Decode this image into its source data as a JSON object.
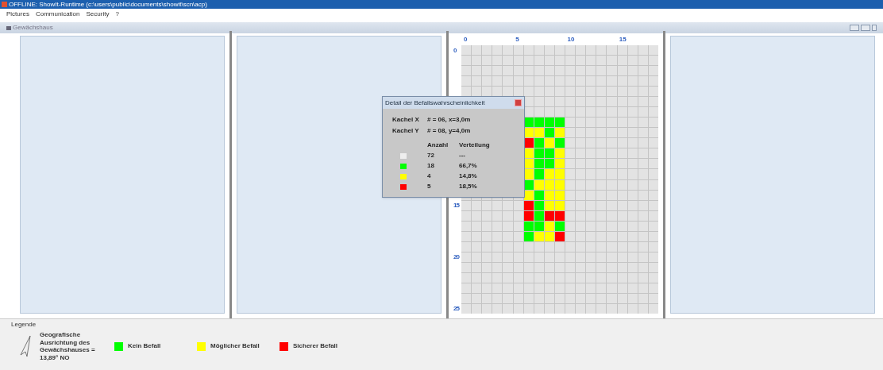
{
  "window": {
    "title": "OFFLINE: ShowIt-Runtime (c:\\users\\public\\documents\\showit\\scn\\acp)"
  },
  "menu": [
    "Pictures",
    "Communication",
    "Security",
    "?"
  ],
  "subwindow": {
    "title": "Gewächshaus"
  },
  "grid": {
    "x_labels": [
      "0",
      "5",
      "10",
      "15"
    ],
    "y_labels": [
      "0",
      "15",
      "20",
      "25"
    ],
    "tile_rows": [
      {
        "cells": [
          {
            "color": "#00ff00"
          },
          {
            "color": "#00ff00"
          },
          {
            "color": "#00ff00"
          },
          {
            "color": "#00ff00"
          }
        ]
      },
      {
        "cells": [
          {
            "color": "#ffff00"
          },
          {
            "color": "#ffff00"
          },
          {
            "color": "#00ff00"
          },
          {
            "color": "#ffff00"
          }
        ]
      },
      {
        "cells": [
          {
            "color": "#ff0000"
          },
          {
            "color": "#00ff00"
          },
          {
            "color": "#ffff00"
          },
          {
            "color": "#00ff00"
          }
        ]
      },
      {
        "cells": [
          {
            "color": "#ffff00"
          },
          {
            "color": "#00ff00"
          },
          {
            "color": "#00ff00"
          },
          {
            "color": "#ffff00"
          }
        ]
      },
      {
        "cells": [
          {
            "color": "#ffff00"
          },
          {
            "color": "#00ff00"
          },
          {
            "color": "#00ff00"
          },
          {
            "color": "#ffff00"
          }
        ]
      },
      {
        "cells": [
          {
            "color": "#ffff00"
          },
          {
            "color": "#00ff00"
          },
          {
            "color": "#ffff00"
          },
          {
            "color": "#ffff00"
          }
        ]
      },
      {
        "cells": [
          {
            "color": "#00ff00"
          },
          {
            "color": "#ffff00"
          },
          {
            "color": "#ffff00"
          },
          {
            "color": "#ffff00"
          }
        ]
      },
      {
        "cells": [
          {
            "color": "#ffff00"
          },
          {
            "color": "#00ff00"
          },
          {
            "color": "#ffff00"
          },
          {
            "color": "#ffff00"
          }
        ]
      },
      {
        "cells": [
          {
            "color": "#ff0000"
          },
          {
            "color": "#00ff00"
          },
          {
            "color": "#ffff00"
          },
          {
            "color": "#ffff00"
          }
        ]
      },
      {
        "cells": [
          {
            "color": "#ff0000"
          },
          {
            "color": "#00ff00"
          },
          {
            "color": "#ff0000"
          },
          {
            "color": "#ff0000"
          }
        ]
      },
      {
        "cells": [
          {
            "color": "#00ff00"
          },
          {
            "color": "#00ff00"
          },
          {
            "color": "#ffff00"
          },
          {
            "color": "#00ff00"
          }
        ]
      },
      {
        "cells": [
          {
            "color": "#00ff00"
          },
          {
            "color": "#ffff00"
          },
          {
            "color": "#ffff00"
          },
          {
            "color": "#ff0000"
          }
        ]
      }
    ]
  },
  "dialog": {
    "title": "Detail der Befallswahrscheinlichkeit",
    "tiles": [
      {
        "label": "Kachel X",
        "value": "# = 06, x=3,0m"
      },
      {
        "label": "Kachel Y",
        "value": "# = 08, y=4,0m"
      }
    ],
    "columns": [
      "Anzahl",
      "Verteilung"
    ],
    "rows": [
      {
        "color": "#eeeeee",
        "count": "72",
        "share": "---"
      },
      {
        "color": "#00ff00",
        "count": "18",
        "share": "66,7%"
      },
      {
        "color": "#ffff00",
        "count": "4",
        "share": "14,8%"
      },
      {
        "color": "#ff0000",
        "count": "5",
        "share": "18,5%"
      }
    ]
  },
  "legend": {
    "title": "Legende",
    "orientation": "Geografische Ausrichtung des Gewächshauses = 13,89° NO",
    "items": [
      {
        "color": "#00ff00",
        "label": "Kein Befall"
      },
      {
        "color": "#ffff00",
        "label": "Möglicher Befall"
      },
      {
        "color": "#ff0000",
        "label": "Sicherer Befall"
      }
    ]
  }
}
